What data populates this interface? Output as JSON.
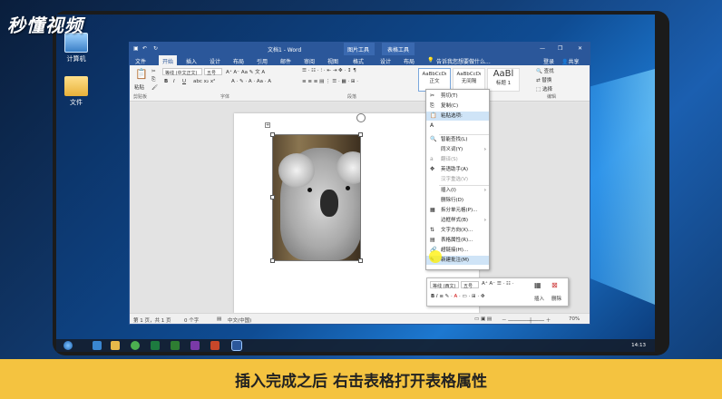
{
  "logo": {
    "text": "秒懂视频"
  },
  "desktop": {
    "icons": [
      {
        "label": "计算机",
        "icon": "computer-icon"
      },
      {
        "label": "文件",
        "icon": "folder-icon"
      }
    ]
  },
  "word": {
    "window_title": "文档1 - Word",
    "context_group_picture": "图片工具",
    "context_group_table": "表格工具",
    "tabs": [
      "文件",
      "开始",
      "插入",
      "设计",
      "布局",
      "引用",
      "邮件",
      "审阅",
      "视图",
      "格式",
      "设计",
      "布局"
    ],
    "active_tab": "开始",
    "tell_me_placeholder": "告诉我您想要做什么...",
    "sign_in": "登录",
    "share": "共享",
    "ribbon": {
      "paste_label": "粘贴",
      "font_name": "等线 (中文正文)",
      "font_size": "五号",
      "group_clipboard": "剪贴板",
      "group_font": "字体",
      "group_paragraph": "段落",
      "group_editing": "编辑",
      "styles": [
        {
          "preview": "AaBbCcDı",
          "name": "正文"
        },
        {
          "preview": "AaBbCcDı",
          "name": "无间隔"
        },
        {
          "preview": "AaBl",
          "name": "标题 1"
        }
      ],
      "find": "查找",
      "replace": "替换",
      "select": "选择"
    },
    "status": {
      "page": "第 1 页，共 1 页",
      "words": "0 个字",
      "language": "中文(中国)",
      "zoom": "70%"
    }
  },
  "context_menu": {
    "items": [
      {
        "label": "剪切(T)",
        "icon": "scissors-icon",
        "dim": false
      },
      {
        "label": "复制(C)",
        "icon": "copy-icon",
        "dim": false
      },
      {
        "label": "粘贴选项:",
        "icon": "paste-icon",
        "dim": false,
        "highlight": true
      },
      {
        "label": "",
        "icon": "paste-text-icon",
        "dim": false
      },
      {
        "label": "智能查找(L)",
        "icon": "search-icon",
        "dim": false
      },
      {
        "label": "同义词(Y)",
        "icon": "",
        "dim": false,
        "submenu": true
      },
      {
        "label": "翻译(S)",
        "icon": "translate-icon",
        "dim": true
      },
      {
        "label": "英语助手(A)",
        "icon": "english-assist-icon",
        "dim": false
      },
      {
        "label": "汉字重选(V)",
        "icon": "",
        "dim": true
      },
      {
        "label": "插入(I)",
        "icon": "",
        "dim": false,
        "submenu": true
      },
      {
        "label": "删除行(D)",
        "icon": "",
        "dim": false
      },
      {
        "label": "拆分单元格(P)...",
        "icon": "split-cells-icon",
        "dim": false
      },
      {
        "label": "边框样式(B)",
        "icon": "",
        "dim": false,
        "submenu": true
      },
      {
        "label": "文字方向(X)...",
        "icon": "text-direction-icon",
        "dim": false
      },
      {
        "label": "表格属性(R)...",
        "icon": "table-properties-icon",
        "dim": false
      },
      {
        "label": "超链接(H)...",
        "icon": "hyperlink-icon",
        "dim": false
      },
      {
        "label": "新建批注(M)",
        "icon": "new-comment-icon",
        "dim": false,
        "highlight": true
      }
    ]
  },
  "mini_toolbar": {
    "font_name": "等线 (西文)",
    "font_size": "五号",
    "insert_label": "插入",
    "delete_label": "删除"
  },
  "taskbar": {
    "clock": "14:13"
  },
  "caption": "插入完成之后 右击表格打开表格属性"
}
